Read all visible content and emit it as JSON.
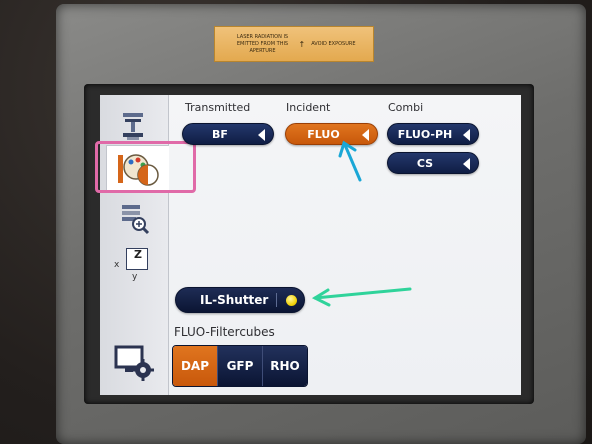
{
  "device": {
    "warning_label": {
      "left_text": "LASER RADIATION IS EMITTED FROM THIS APERTURE",
      "arrow": "↑",
      "right_text": "AVOID EXPOSURE"
    }
  },
  "tabs": [
    {
      "icon": "microscope-icon",
      "active": false
    },
    {
      "icon": "palette-contrast-icon",
      "active": true
    },
    {
      "icon": "slide-zoom-icon",
      "active": false
    },
    {
      "icon": "xyz-axis-icon",
      "active": false,
      "labels": {
        "x": "x",
        "y": "y",
        "z": "Z"
      }
    },
    {
      "icon": "monitor-settings-icon",
      "active": false
    }
  ],
  "illumination": {
    "transmitted": {
      "header": "Transmitted",
      "buttons": [
        {
          "label": "BF",
          "active": false
        }
      ]
    },
    "incident": {
      "header": "Incident",
      "buttons": [
        {
          "label": "FLUO",
          "active": true
        }
      ]
    },
    "combi": {
      "header": "Combi",
      "buttons": [
        {
          "label": "FLUO-PH",
          "active": false
        },
        {
          "label": "CS",
          "active": false
        }
      ]
    }
  },
  "shutter": {
    "label": "IL-Shutter",
    "indicator_color": "#f2d30c",
    "state": "open"
  },
  "filtercubes": {
    "title": "FLUO-Filtercubes",
    "items": [
      {
        "label": "DAP",
        "active": true
      },
      {
        "label": "GFP",
        "active": false
      },
      {
        "label": "RHO",
        "active": false
      }
    ]
  },
  "colors": {
    "active_orange": "#d5661a",
    "button_navy": "#17275a",
    "highlight_pink": "#e06aa8",
    "arrow_blue": "#1aa7d6",
    "arrow_green": "#2fd39a"
  }
}
